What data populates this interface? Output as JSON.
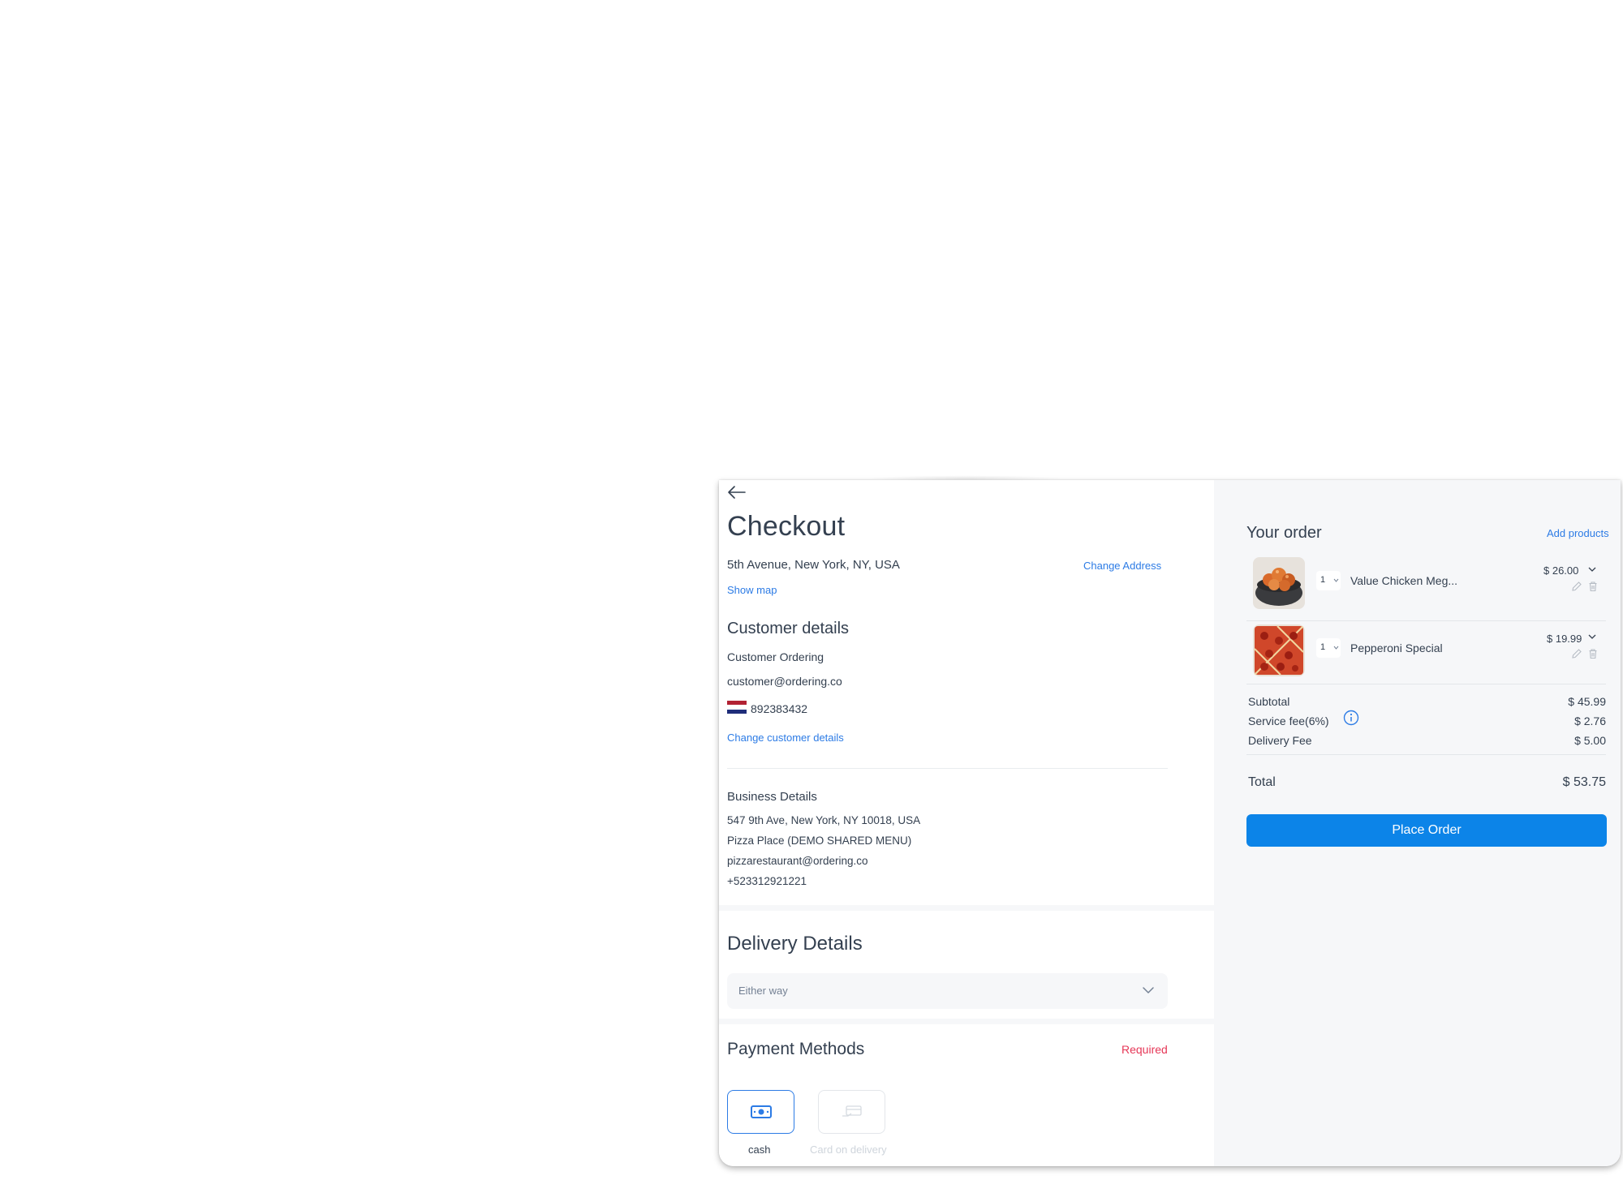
{
  "checkout": {
    "title": "Checkout",
    "address": "5th Avenue, New York, NY, USA",
    "change_address": "Change Address",
    "show_map": "Show map"
  },
  "customer": {
    "title": "Customer details",
    "name": "Customer Ordering",
    "email": "customer@ordering.co",
    "phone": "892383432",
    "change_label": "Change customer details"
  },
  "business": {
    "title": "Business Details",
    "address": "547 9th Ave, New York, NY 10018, USA",
    "name": "Pizza Place (DEMO SHARED MENU)",
    "email": "pizzarestaurant@ordering.co",
    "phone": "+523312921221"
  },
  "delivery": {
    "title": "Delivery Details",
    "selected_option": "Either way"
  },
  "payment": {
    "title": "Payment Methods",
    "required_label": "Required",
    "methods": [
      {
        "label": "cash",
        "icon": "cash-icon",
        "selected": true
      },
      {
        "label": "Card on delivery",
        "icon": "card-icon",
        "selected": false
      }
    ]
  },
  "order": {
    "title": "Your order",
    "add_products": "Add products",
    "items": [
      {
        "quantity": "1",
        "name": "Value Chicken Meg...",
        "price": "$ 26.00",
        "image": "chicken-bowl"
      },
      {
        "quantity": "1",
        "name": "Pepperoni Special",
        "price": "$ 19.99",
        "image": "pepperoni-pizza"
      }
    ],
    "summary": {
      "subtotal_label": "Subtotal",
      "subtotal": "$ 45.99",
      "service_fee_label": "Service fee(6%)",
      "service_fee": "$ 2.76",
      "delivery_fee_label": "Delivery Fee",
      "delivery_fee": "$ 5.00",
      "total_label": "Total",
      "total": "$ 53.75"
    },
    "place_order": "Place Order"
  },
  "colors": {
    "accent": "#2c7be5",
    "button": "#0c84e8",
    "required": "#e63757",
    "panel_bg": "#f6f7f9"
  }
}
